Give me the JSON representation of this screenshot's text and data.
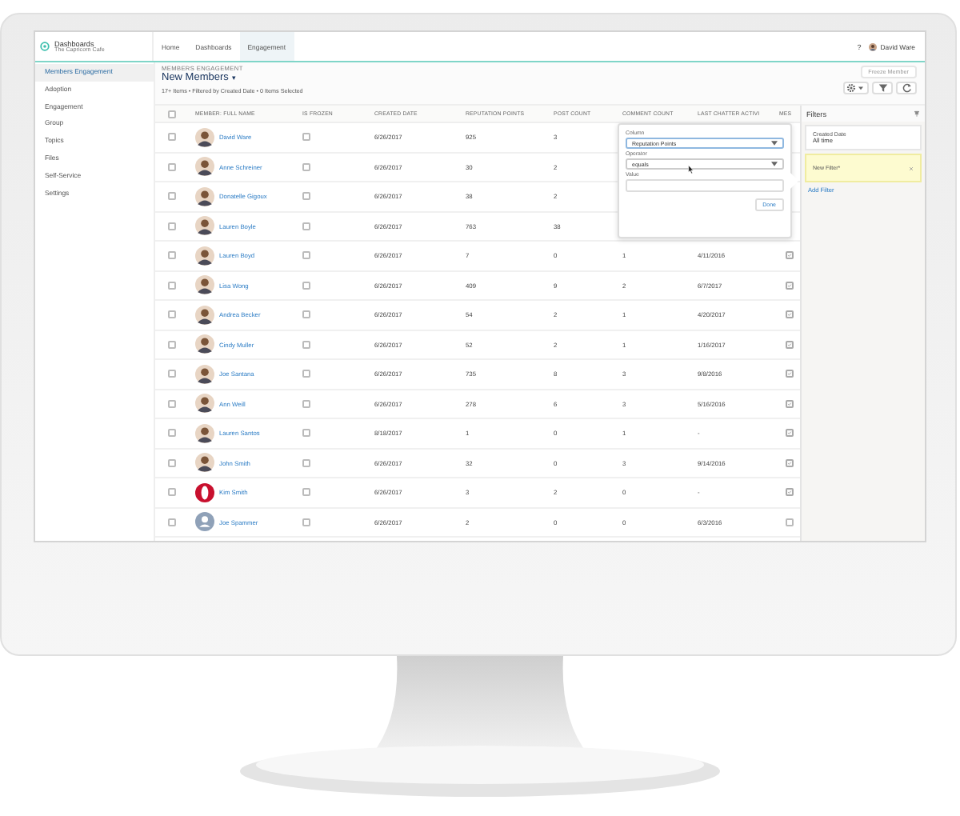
{
  "header": {
    "app_title": "Dashboards",
    "app_subtitle": "The Capricorn Cafe",
    "help": "?",
    "user": "David Ware",
    "tabs": [
      {
        "label": "Home",
        "selected": false
      },
      {
        "label": "Dashboards",
        "selected": false
      },
      {
        "label": "Engagement",
        "selected": true
      }
    ]
  },
  "sidebar": {
    "items": [
      {
        "label": "Members Engagement",
        "selected": true
      },
      {
        "label": "Adoption",
        "selected": false
      },
      {
        "label": "Engagement",
        "selected": false
      },
      {
        "label": "Group",
        "selected": false
      },
      {
        "label": "Topics",
        "selected": false
      },
      {
        "label": "Files",
        "selected": false
      },
      {
        "label": "Self-Service",
        "selected": false
      },
      {
        "label": "Settings",
        "selected": false
      }
    ]
  },
  "list": {
    "eyebrow": "MEMBERS ENGAGEMENT",
    "title": "New Members",
    "title_caret": "▾",
    "summary": "17+ Items • Filtered by Created Date • 0 Items Selected",
    "freeze_button": {
      "label": "Freeze Member",
      "disabled": true
    }
  },
  "table": {
    "all_selected": false,
    "columns": [
      "MEMBER: FULL NAME",
      "IS FROZEN",
      "CREATED DATE",
      "REPUTATION POINTS",
      "POST COUNT",
      "COMMENT COUNT",
      "LAST CHATTER ACTIVI",
      "MES"
    ],
    "rows": [
      {
        "selected": false,
        "avatar": {
          "kind": "photo"
        },
        "name": "David Ware",
        "frozen": false,
        "created": "6/26/2017",
        "reputation": "925",
        "posts": "3"
      },
      {
        "selected": false,
        "avatar": {
          "kind": "photo"
        },
        "name": "Anne Schreiner",
        "frozen": false,
        "created": "6/26/2017",
        "reputation": "30",
        "posts": "2"
      },
      {
        "selected": false,
        "avatar": {
          "kind": "photo"
        },
        "name": "Donatelle Gigoux",
        "frozen": false,
        "created": "6/26/2017",
        "reputation": "38",
        "posts": "2"
      },
      {
        "selected": false,
        "avatar": {
          "kind": "photo"
        },
        "name": "Lauren Boyle",
        "frozen": false,
        "created": "6/26/2017",
        "reputation": "763",
        "posts": "38"
      },
      {
        "selected": false,
        "avatar": {
          "kind": "photo"
        },
        "name": "Lauren Boyd",
        "frozen": false,
        "created": "6/26/2017",
        "reputation": "7",
        "posts": "0",
        "comments": "1",
        "last_activity": "4/11/2016",
        "col8_checked": true
      },
      {
        "selected": false,
        "avatar": {
          "kind": "photo"
        },
        "name": "Lisa Wong",
        "frozen": false,
        "created": "6/26/2017",
        "reputation": "409",
        "posts": "9",
        "comments": "2",
        "last_activity": "6/7/2017",
        "col8_checked": true
      },
      {
        "selected": false,
        "avatar": {
          "kind": "photo"
        },
        "name": "Andrea Becker",
        "frozen": false,
        "created": "6/26/2017",
        "reputation": "54",
        "posts": "2",
        "comments": "1",
        "last_activity": "4/20/2017",
        "col8_checked": true
      },
      {
        "selected": false,
        "avatar": {
          "kind": "photo"
        },
        "name": "Cindy Muller",
        "frozen": false,
        "created": "6/26/2017",
        "reputation": "52",
        "posts": "2",
        "comments": "1",
        "last_activity": "1/16/2017",
        "col8_checked": true
      },
      {
        "selected": false,
        "avatar": {
          "kind": "photo"
        },
        "name": "Joe Santana",
        "frozen": false,
        "created": "6/26/2017",
        "reputation": "735",
        "posts": "8",
        "comments": "3",
        "last_activity": "9/8/2016",
        "col8_checked": true
      },
      {
        "selected": false,
        "avatar": {
          "kind": "photo"
        },
        "name": "Ann Weill",
        "frozen": false,
        "created": "6/26/2017",
        "reputation": "278",
        "posts": "6",
        "comments": "3",
        "last_activity": "5/16/2016",
        "col8_checked": true
      },
      {
        "selected": false,
        "avatar": {
          "kind": "photo"
        },
        "name": "Lauren Santos",
        "frozen": false,
        "created": "8/18/2017",
        "reputation": "1",
        "posts": "0",
        "comments": "1",
        "last_activity": "-",
        "col8_checked": true
      },
      {
        "selected": false,
        "avatar": {
          "kind": "photo"
        },
        "name": "John Smith",
        "frozen": false,
        "created": "6/26/2017",
        "reputation": "32",
        "posts": "0",
        "comments": "3",
        "last_activity": "9/14/2016",
        "col8_checked": true
      },
      {
        "selected": false,
        "avatar": {
          "kind": "logo"
        },
        "name": "Kim Smith",
        "frozen": false,
        "created": "6/26/2017",
        "reputation": "3",
        "posts": "2",
        "comments": "0",
        "last_activity": "-",
        "col8_checked": true
      },
      {
        "selected": false,
        "avatar": {
          "kind": "default"
        },
        "name": "Joe Spammer",
        "frozen": false,
        "created": "6/26/2017",
        "reputation": "2",
        "posts": "0",
        "comments": "0",
        "last_activity": "6/3/2016",
        "col8_checked": false
      }
    ]
  },
  "filter_popover": {
    "column_label": "Column",
    "column_value": "Reputation Points",
    "operator_label": "Operator",
    "operator_value": "equals",
    "value_label": "Value",
    "done": "Done"
  },
  "filters": {
    "title": "Filters",
    "items": [
      {
        "name": "Created Date",
        "value": "All time",
        "kind": "saved"
      },
      {
        "name": "New Filter*",
        "kind": "new"
      }
    ],
    "add": "Add Filter"
  }
}
